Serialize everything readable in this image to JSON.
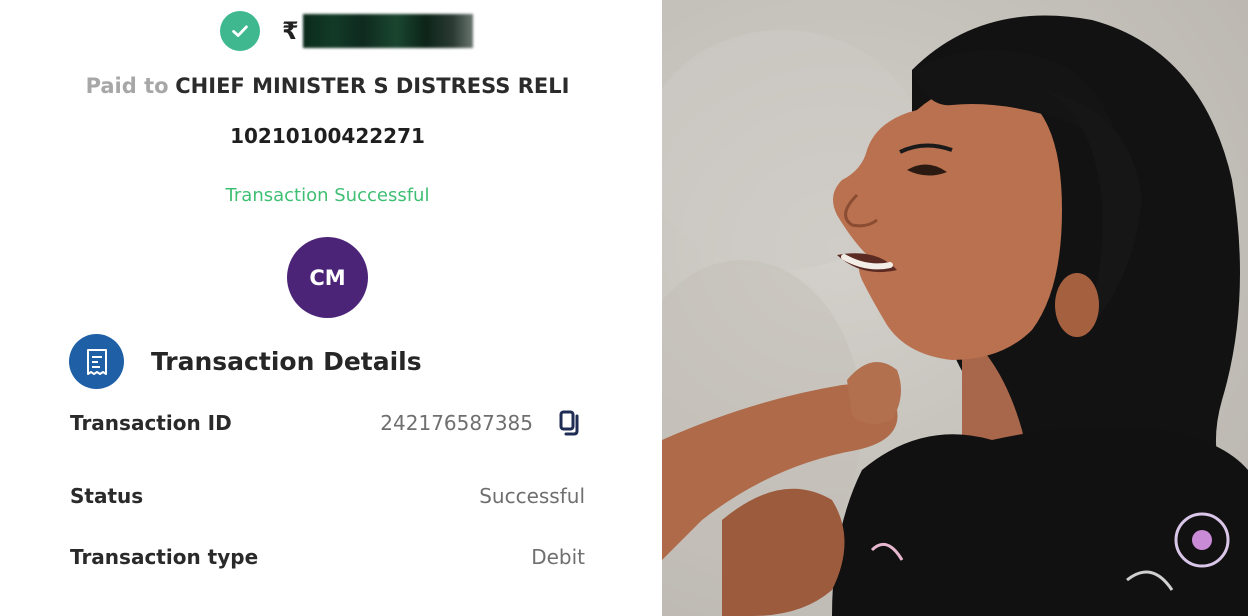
{
  "receipt": {
    "amount_symbol": "₹",
    "paid_to_label": "Paid to",
    "payee_name": "CHIEF MINISTER S DISTRESS RELI",
    "account_number": "10210100422271",
    "status_message": "Transaction Successful",
    "avatar_initials": "CM",
    "details_title": "Transaction Details",
    "rows": [
      {
        "label": "Transaction ID",
        "value": "242176587385"
      },
      {
        "label": "Status",
        "value": "Successful"
      },
      {
        "label": "Transaction type",
        "value": "Debit"
      }
    ]
  },
  "colors": {
    "success_green": "#3fbf74",
    "check_badge": "#3fb88f",
    "avatar_purple": "#4b2478",
    "receipt_icon_blue": "#1f5fa6"
  },
  "icons": [
    "check-circle-icon",
    "receipt-icon",
    "copy-icon"
  ]
}
